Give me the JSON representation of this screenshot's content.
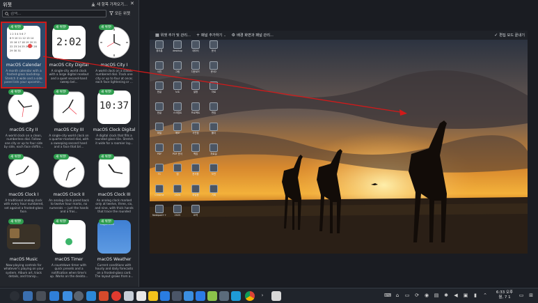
{
  "panel": {
    "title": "위젯",
    "get_new_label": "새 항목 가져오기...",
    "search_placeholder": "검색...",
    "filter_label": "모든 위젯"
  },
  "widgets": [
    {
      "badge": "새 위젯!",
      "name": "macOS Calendar",
      "desc": "A month calendar with a frosted-glass backdrop. Stretch it wide and a side panel lists your upcomin..."
    },
    {
      "badge": "새 위젯!",
      "name": "macOS City Digital",
      "desc": "A single-city world clock with a large digital readout and a quiet second-hand sweep bel..."
    },
    {
      "badge": "새 위젯!",
      "name": "macOS City I",
      "desc": "A world clock on a classic numbered dial. Track one city or up to four at once; each face lightening or ..."
    },
    {
      "badge": "새 위젯!",
      "name": "macOS City II",
      "desc": "A world clock on a clean, numberless dial. Follow one city or up to four side by side, each face shiftin..."
    },
    {
      "badge": "새 위젯!",
      "name": "macOS City III",
      "desc": "A single-city world clock on a quarter-marked dial, with a sweeping second hand and a face that bri..."
    },
    {
      "badge": "새 위젯!",
      "name": "macOS Clock Digital",
      "desc": "A digital clock that fills a rounded glass tile. Stretch it wide for a roomier lay..."
    },
    {
      "badge": "새 위젯!",
      "name": "macOS Clock I",
      "desc": "A traditional analog clock with every hour numbered, set against a frosted-glass face."
    },
    {
      "badge": "새 위젯!",
      "name": "macOS Clock II",
      "desc": "An analog clock pared back to twelve hour marks, no numerals — just the hands and a fros..."
    },
    {
      "badge": "새 위젯!",
      "name": "macOS Clock III",
      "desc": "An analog clock marked only at twelve, three, six, and nine, with thick hands that trace the rounded glass f..."
    },
    {
      "badge": "새 위젯!",
      "name": "macOS Music",
      "desc": "Now-playing controls for whatever's playing on your system. Album art, track details, and transp..."
    },
    {
      "badge": "새 위젯!",
      "name": "macOS Timer",
      "desc": "A countdown timer with quick presets and a notification when time's up. Works on the deskto..."
    },
    {
      "badge": "새 위젯!",
      "name": "macOS Weather",
      "desc": "Current conditions with hourly and daily forecasts on a frosted-glass card. The layout grows from a..."
    }
  ],
  "thumbs": {
    "digital_time_top": "2:02",
    "clock_digital_time": "10:37",
    "calendar_grid": "1 2 3 4 5 6 7\n8 9 10 11 12 13 14\n15 16 17 18 19 20 21\n22 23 24 25 26 27 28\n29 30 31",
    "weather_city": "Cupertino"
  },
  "editbar": {
    "add_widget": "위젯 추가 및 관리...",
    "add_panel": "패널 추가하기",
    "wallpaper": "배경 화면과 패널 관리...",
    "done": "편집 모드 끝내기"
  },
  "desktop_icons": [
    {
      "label": "휴지통"
    },
    {
      "label": "desktop"
    },
    {
      "label": "데이터"
    },
    {
      "label": "문서"
    },
    {
      "label": "사진"
    },
    {
      "label": "그림"
    },
    {
      "label": "다운로드"
    },
    {
      "label": "문서2"
    },
    {
      "label": "한글"
    },
    {
      "label": "노트"
    },
    {
      "label": "설정"
    },
    {
      "label": "자료"
    },
    {
      "label": "한글"
    },
    {
      "label": "스크립트"
    },
    {
      "label": "프로젝트"
    },
    {
      "label": "편집"
    },
    {
      "label": "파일"
    },
    {
      "label": "메모"
    },
    {
      "label": "사진첩"
    },
    {
      "label": "폴더"
    },
    {
      "label": "PDF"
    },
    {
      "label": "PDF 문서"
    },
    {
      "label": "백업"
    },
    {
      "label": "자료실"
    },
    {
      "label": "FC"
    },
    {
      "label": "앱"
    },
    {
      "label": "문서함"
    },
    {
      "label": "보관"
    },
    {
      "label": "Chrome"
    },
    {
      "label": "2024"
    },
    {
      "label": "파일함"
    },
    {
      "label": "기록"
    },
    {
      "label": "Notepad++"
    },
    {
      "label": "2025"
    },
    {
      "label": "요약"
    }
  ],
  "taskbar": {
    "time": "6:33 오후",
    "date": "월, 7 1"
  },
  "colors": {
    "badge_green": "#2f9d4e",
    "selection_red": "#d11a1a",
    "selected_bg": "#2e4b6b",
    "panel_bg": "#23262c"
  }
}
